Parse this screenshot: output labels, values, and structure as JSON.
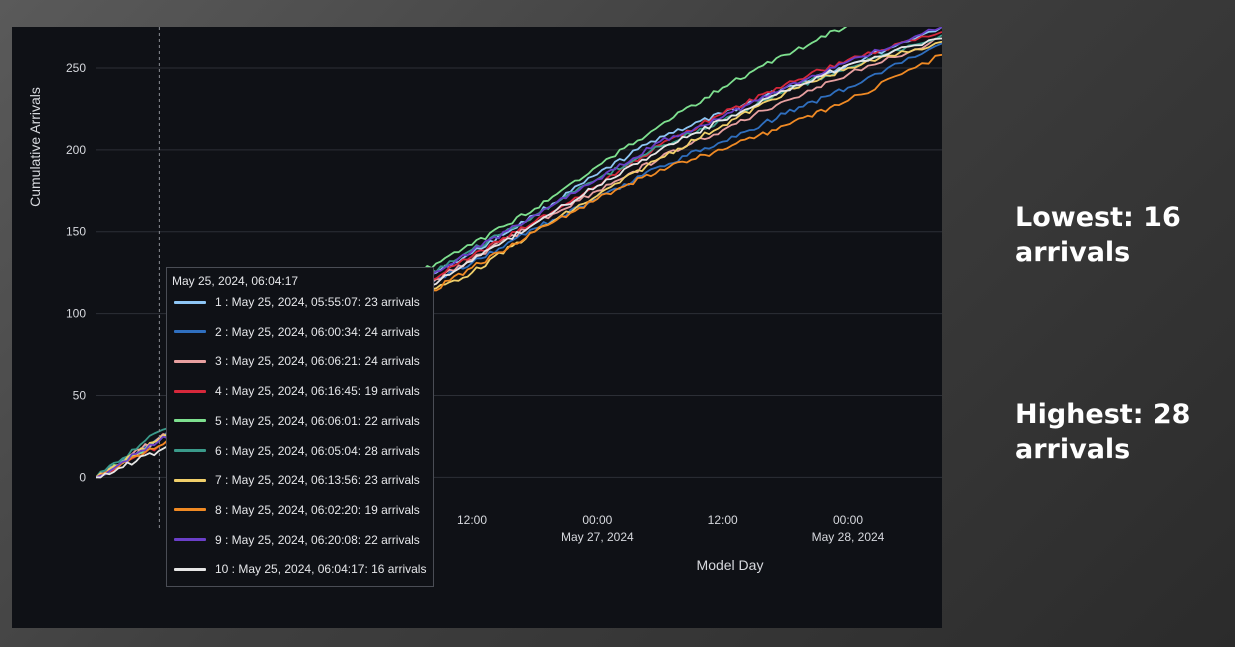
{
  "side_stats": {
    "lowest": "Lowest: 16 arrivals",
    "highest": "Highest: 28 arrivals"
  },
  "chart_data": {
    "type": "line",
    "ylabel": "Cumulative Arrivals",
    "xlabel": "Model Day",
    "y_ticks": [
      0,
      50,
      100,
      150,
      200,
      250
    ],
    "ylim": [
      -12,
      275
    ],
    "xlim": [
      "2024-05-25 00:00",
      "2024-05-28 09:00"
    ],
    "x_ticks": [
      {
        "time": "2024-05-26 12:00",
        "label": "12:00",
        "sublabel": ""
      },
      {
        "time": "2024-05-27 00:00",
        "label": "00:00",
        "sublabel": "May 27, 2024"
      },
      {
        "time": "2024-05-27 12:00",
        "label": "12:00",
        "sublabel": ""
      },
      {
        "time": "2024-05-28 00:00",
        "label": "00:00",
        "sublabel": "May 28, 2024"
      }
    ],
    "hover_time": "2024-05-25 06:04",
    "grid": true,
    "series": [
      {
        "name": "1",
        "color": "#8ec6f5",
        "points": [
          [
            "2024-05-25 00:00",
            0
          ],
          [
            "2024-05-25 06:00",
            23
          ],
          [
            "2024-05-25 12:00",
            45
          ],
          [
            "2024-05-25 18:00",
            70
          ],
          [
            "2024-05-26 00:00",
            92
          ],
          [
            "2024-05-26 06:00",
            116
          ],
          [
            "2024-05-26 12:00",
            137
          ],
          [
            "2024-05-26 18:00",
            160
          ],
          [
            "2024-05-27 00:00",
            185
          ],
          [
            "2024-05-27 06:00",
            208
          ],
          [
            "2024-05-27 12:00",
            222
          ],
          [
            "2024-05-27 18:00",
            238
          ],
          [
            "2024-05-28 00:00",
            252
          ],
          [
            "2024-05-28 09:00",
            275
          ]
        ]
      },
      {
        "name": "2",
        "color": "#2f6fbf",
        "points": [
          [
            "2024-05-25 00:00",
            0
          ],
          [
            "2024-05-25 06:00",
            24
          ],
          [
            "2024-05-25 12:00",
            44
          ],
          [
            "2024-05-25 18:00",
            66
          ],
          [
            "2024-05-26 00:00",
            88
          ],
          [
            "2024-05-26 06:00",
            111
          ],
          [
            "2024-05-26 12:00",
            131
          ],
          [
            "2024-05-26 18:00",
            152
          ],
          [
            "2024-05-27 00:00",
            170
          ],
          [
            "2024-05-27 06:00",
            190
          ],
          [
            "2024-05-27 12:00",
            205
          ],
          [
            "2024-05-27 18:00",
            222
          ],
          [
            "2024-05-28 00:00",
            238
          ],
          [
            "2024-05-28 09:00",
            265
          ]
        ]
      },
      {
        "name": "3",
        "color": "#e8a0a0",
        "points": [
          [
            "2024-05-25 00:00",
            0
          ],
          [
            "2024-05-25 06:00",
            24
          ],
          [
            "2024-05-25 12:00",
            44
          ],
          [
            "2024-05-25 18:00",
            67
          ],
          [
            "2024-05-26 00:00",
            89
          ],
          [
            "2024-05-26 06:00",
            112
          ],
          [
            "2024-05-26 12:00",
            133
          ],
          [
            "2024-05-26 18:00",
            155
          ],
          [
            "2024-05-27 00:00",
            175
          ],
          [
            "2024-05-27 06:00",
            195
          ],
          [
            "2024-05-27 12:00",
            212
          ],
          [
            "2024-05-27 18:00",
            230
          ],
          [
            "2024-05-28 00:00",
            246
          ],
          [
            "2024-05-28 09:00",
            268
          ]
        ]
      },
      {
        "name": "4",
        "color": "#d6283b",
        "points": [
          [
            "2024-05-25 00:00",
            0
          ],
          [
            "2024-05-25 06:00",
            19
          ],
          [
            "2024-05-25 12:00",
            42
          ],
          [
            "2024-05-25 18:00",
            68
          ],
          [
            "2024-05-26 00:00",
            91
          ],
          [
            "2024-05-26 06:00",
            114
          ],
          [
            "2024-05-26 12:00",
            135
          ],
          [
            "2024-05-26 18:00",
            156
          ],
          [
            "2024-05-27 00:00",
            178
          ],
          [
            "2024-05-27 06:00",
            203
          ],
          [
            "2024-05-27 12:00",
            222
          ],
          [
            "2024-05-27 18:00",
            240
          ],
          [
            "2024-05-28 00:00",
            255
          ],
          [
            "2024-05-28 09:00",
            272
          ]
        ]
      },
      {
        "name": "5",
        "color": "#7ee08f",
        "points": [
          [
            "2024-05-25 00:00",
            0
          ],
          [
            "2024-05-25 06:00",
            22
          ],
          [
            "2024-05-25 12:00",
            48
          ],
          [
            "2024-05-25 18:00",
            74
          ],
          [
            "2024-05-26 00:00",
            98
          ],
          [
            "2024-05-26 06:00",
            122
          ],
          [
            "2024-05-26 12:00",
            142
          ],
          [
            "2024-05-26 18:00",
            164
          ],
          [
            "2024-05-27 00:00",
            190
          ],
          [
            "2024-05-27 06:00",
            215
          ],
          [
            "2024-05-27 12:00",
            238
          ],
          [
            "2024-05-27 18:00",
            258
          ],
          [
            "2024-05-28 00:00",
            276
          ]
        ]
      },
      {
        "name": "6",
        "color": "#3a9a8a",
        "points": [
          [
            "2024-05-25 00:00",
            0
          ],
          [
            "2024-05-25 06:00",
            28
          ],
          [
            "2024-05-25 12:00",
            50
          ],
          [
            "2024-05-25 18:00",
            73
          ],
          [
            "2024-05-26 00:00",
            96
          ],
          [
            "2024-05-26 06:00",
            118
          ],
          [
            "2024-05-26 12:00",
            139
          ],
          [
            "2024-05-26 18:00",
            160
          ],
          [
            "2024-05-27 00:00",
            182
          ],
          [
            "2024-05-27 06:00",
            202
          ],
          [
            "2024-05-27 12:00",
            218
          ],
          [
            "2024-05-27 18:00",
            236
          ],
          [
            "2024-05-28 00:00",
            250
          ],
          [
            "2024-05-28 09:00",
            270
          ]
        ]
      },
      {
        "name": "7",
        "color": "#f0cf6a",
        "points": [
          [
            "2024-05-25 00:00",
            0
          ],
          [
            "2024-05-25 06:00",
            23
          ],
          [
            "2024-05-25 12:00",
            43
          ],
          [
            "2024-05-25 18:00",
            65
          ],
          [
            "2024-05-26 00:00",
            86
          ],
          [
            "2024-05-26 06:00",
            108
          ],
          [
            "2024-05-26 12:00",
            125
          ],
          [
            "2024-05-26 18:00",
            150
          ],
          [
            "2024-05-27 00:00",
            172
          ],
          [
            "2024-05-27 06:00",
            195
          ],
          [
            "2024-05-27 12:00",
            215
          ],
          [
            "2024-05-27 18:00",
            235
          ],
          [
            "2024-05-28 00:00",
            250
          ],
          [
            "2024-05-28 09:00",
            266
          ]
        ]
      },
      {
        "name": "8",
        "color": "#f08a24",
        "points": [
          [
            "2024-05-25 00:00",
            0
          ],
          [
            "2024-05-25 06:00",
            19
          ],
          [
            "2024-05-25 12:00",
            40
          ],
          [
            "2024-05-25 18:00",
            63
          ],
          [
            "2024-05-26 00:00",
            85
          ],
          [
            "2024-05-26 06:00",
            106
          ],
          [
            "2024-05-26 12:00",
            128
          ],
          [
            "2024-05-26 18:00",
            150
          ],
          [
            "2024-05-27 00:00",
            170
          ],
          [
            "2024-05-27 06:00",
            188
          ],
          [
            "2024-05-27 12:00",
            200
          ],
          [
            "2024-05-27 18:00",
            215
          ],
          [
            "2024-05-28 00:00",
            230
          ],
          [
            "2024-05-28 09:00",
            258
          ]
        ]
      },
      {
        "name": "9",
        "color": "#6a3fc8",
        "points": [
          [
            "2024-05-25 00:00",
            0
          ],
          [
            "2024-05-25 06:00",
            22
          ],
          [
            "2024-05-25 12:00",
            45
          ],
          [
            "2024-05-25 18:00",
            70
          ],
          [
            "2024-05-26 00:00",
            93
          ],
          [
            "2024-05-26 06:00",
            116
          ],
          [
            "2024-05-26 12:00",
            138
          ],
          [
            "2024-05-26 18:00",
            160
          ],
          [
            "2024-05-27 00:00",
            182
          ],
          [
            "2024-05-27 06:00",
            205
          ],
          [
            "2024-05-27 12:00",
            220
          ],
          [
            "2024-05-27 18:00",
            238
          ],
          [
            "2024-05-28 00:00",
            254
          ],
          [
            "2024-05-28 09:00",
            275
          ]
        ]
      },
      {
        "name": "10",
        "color": "#e6e6e6",
        "points": [
          [
            "2024-05-25 00:00",
            0
          ],
          [
            "2024-05-25 06:00",
            16
          ],
          [
            "2024-05-25 12:00",
            40
          ],
          [
            "2024-05-25 18:00",
            65
          ],
          [
            "2024-05-26 00:00",
            88
          ],
          [
            "2024-05-26 06:00",
            110
          ],
          [
            "2024-05-26 12:00",
            132
          ],
          [
            "2024-05-26 18:00",
            155
          ],
          [
            "2024-05-27 00:00",
            178
          ],
          [
            "2024-05-27 06:00",
            200
          ],
          [
            "2024-05-27 12:00",
            218
          ],
          [
            "2024-05-27 18:00",
            236
          ],
          [
            "2024-05-28 00:00",
            252
          ],
          [
            "2024-05-28 09:00",
            268
          ]
        ]
      }
    ],
    "tooltip": {
      "title": "May 25, 2024, 06:04:17",
      "rows": [
        {
          "text": "1 : May 25, 2024, 05:55:07: 23 arrivals",
          "color": "#8ec6f5"
        },
        {
          "text": "2 : May 25, 2024, 06:00:34: 24 arrivals",
          "color": "#2f6fbf"
        },
        {
          "text": "3 : May 25, 2024, 06:06:21: 24 arrivals",
          "color": "#e8a0a0"
        },
        {
          "text": "4 : May 25, 2024, 06:16:45: 19 arrivals",
          "color": "#d6283b"
        },
        {
          "text": "5 : May 25, 2024, 06:06:01: 22 arrivals",
          "color": "#7ee08f"
        },
        {
          "text": "6 : May 25, 2024, 06:05:04: 28 arrivals",
          "color": "#3a9a8a"
        },
        {
          "text": "7 : May 25, 2024, 06:13:56: 23 arrivals",
          "color": "#f0cf6a"
        },
        {
          "text": "8 : May 25, 2024, 06:02:20: 19 arrivals",
          "color": "#f08a24"
        },
        {
          "text": "9 : May 25, 2024, 06:20:08: 22 arrivals",
          "color": "#6a3fc8"
        },
        {
          "text": "10 : May 25, 2024, 06:04:17: 16 arrivals",
          "color": "#e6e6e6"
        }
      ]
    }
  }
}
